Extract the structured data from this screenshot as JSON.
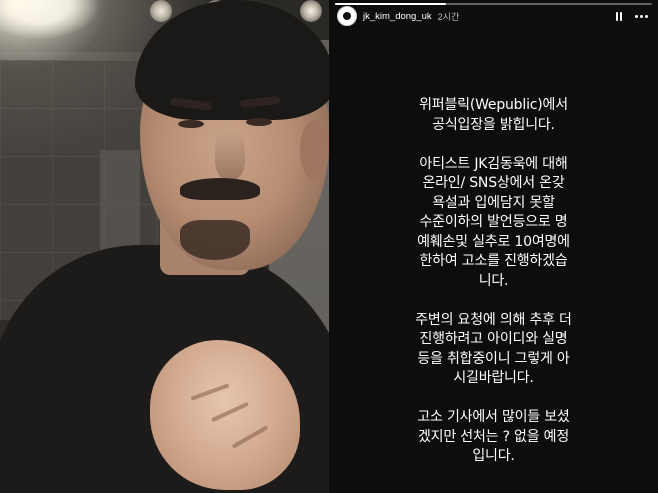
{
  "story": {
    "username": "jk_kim_dong_uk",
    "time_ago": "2시간",
    "progress": 0.35,
    "icons": {
      "pause": "pause-icon",
      "more": "more-options-icon",
      "avatar": "profile-avatar"
    },
    "paragraphs": [
      {
        "lines": [
          "위퍼블릭(Wepublic)에서",
          "공식입장을 밝힙니다."
        ]
      },
      {
        "lines": [
          "아티스트 JK김동욱에 대해",
          "온라인/ SNS상에서 온갖",
          "욕설과 입에담지 못할",
          "수준이하의 발언등으로 명",
          "예훼손및 실추로 10여명에",
          "한하여 고소를 진행하겠습",
          "니다."
        ]
      },
      {
        "lines": [
          "주변의 요청에 의해 추후 더",
          "진행하려고 아이디와 실명",
          "등을 취합중이니 그렇게 아",
          "시길바랍니다."
        ]
      },
      {
        "lines": [
          "고소 기사에서 많이들 보셨",
          "겠지만 선처는 ? 없을 예정",
          "입니다."
        ]
      }
    ]
  },
  "photo": {
    "subject": "man-selfie-video"
  }
}
